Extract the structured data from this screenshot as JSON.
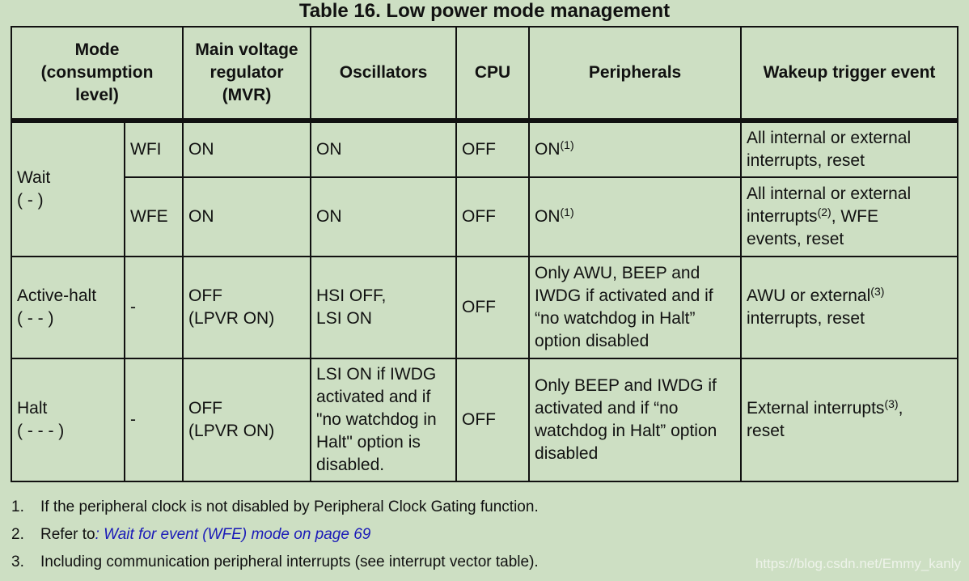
{
  "title": "Table 16. Low power mode management",
  "headers": {
    "mode": "Mode (consumption level)",
    "mode_lines": [
      "Mode",
      "(consumption",
      "level)"
    ],
    "mvr_lines": [
      "Main voltage",
      "regulator",
      "(MVR)"
    ],
    "oscillators": "Oscillators",
    "cpu": "CPU",
    "peripherals": "Peripherals",
    "wakeup": "Wakeup trigger event"
  },
  "rows": [
    {
      "mode": "Wait",
      "level": "( - )",
      "sub": [
        {
          "submode": "WFI",
          "mvr": "ON",
          "oscillators": "ON",
          "cpu": "OFF",
          "peripherals": "ON",
          "peripherals_note": "(1)",
          "wakeup_lines": [
            "All internal or external",
            "interrupts, reset"
          ]
        },
        {
          "submode": "WFE",
          "mvr": "ON",
          "oscillators": "ON",
          "cpu": "OFF",
          "peripherals": "ON",
          "peripherals_note": "(1)",
          "wakeup_a": "All internal or external",
          "wakeup_b": "interrupts",
          "wakeup_note": "(2)",
          "wakeup_c": ", WFE",
          "wakeup_d": "events, reset"
        }
      ]
    },
    {
      "mode": "Active-halt",
      "level": "( - - )",
      "submode": "-",
      "mvr_lines": [
        "OFF",
        "(LPVR ON)"
      ],
      "oscillators_lines": [
        "HSI OFF,",
        "LSI ON"
      ],
      "cpu": "OFF",
      "peripherals_lines": [
        "Only AWU, BEEP and",
        "IWDG if activated and if",
        "“no watchdog in Halt”",
        "option disabled"
      ],
      "wakeup_a": "AWU or external",
      "wakeup_note": "(3)",
      "wakeup_b": "interrupts, reset"
    },
    {
      "mode": "Halt",
      "level": "( - - - )",
      "submode": "-",
      "mvr_lines": [
        "OFF",
        "(LPVR ON)"
      ],
      "oscillators_lines": [
        "LSI ON if IWDG",
        "activated and if",
        "\"no watchdog in",
        "Halt\" option is",
        "disabled."
      ],
      "cpu": "OFF",
      "peripherals_lines": [
        "Only BEEP and IWDG if",
        "activated and if “no",
        "watchdog in Halt” option",
        "disabled"
      ],
      "wakeup_a": "External interrupts",
      "wakeup_note": "(3)",
      "wakeup_b": ",",
      "wakeup_c": "reset"
    }
  ],
  "notes": [
    {
      "num": "1.",
      "text": "If the peripheral clock is not disabled by Peripheral Clock Gating function."
    },
    {
      "num": "2.",
      "text": "Refer to",
      "link": ": Wait for event (WFE) mode on page 69"
    },
    {
      "num": "3.",
      "text": "Including communication peripheral interrupts (see interrupt vector table)."
    }
  ],
  "watermark": "https://blog.csdn.net/Emmy_kanly",
  "colors": {
    "background": "#cddfc3",
    "link": "#1a1ab8",
    "border": "#111111"
  }
}
